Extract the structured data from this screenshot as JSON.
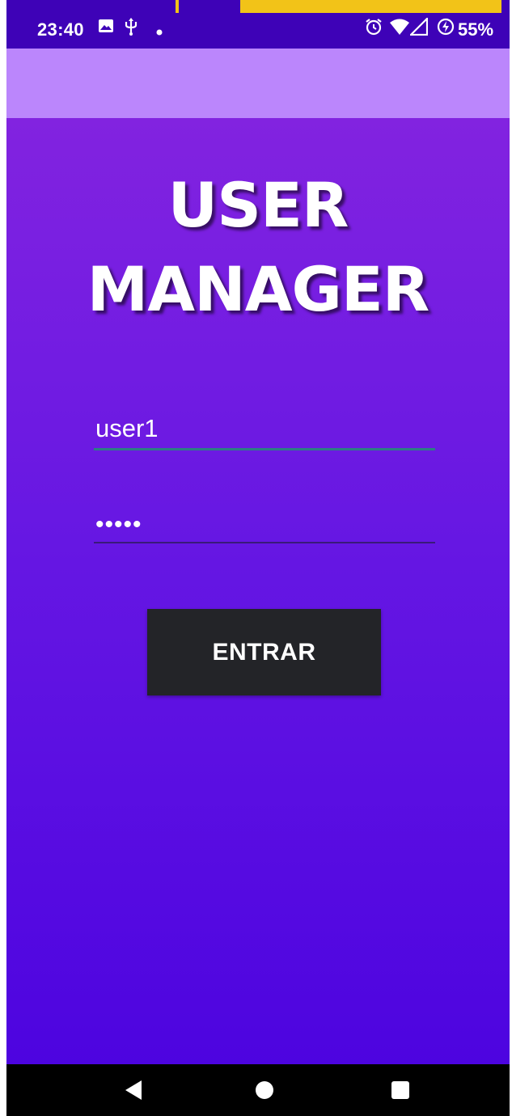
{
  "status_bar": {
    "time": "23:40",
    "battery": "55%",
    "icons": [
      "image-icon",
      "usb-icon",
      "dot-icon",
      "alarm-icon",
      "wifi-icon",
      "signal-icon",
      "battery-saver-icon"
    ]
  },
  "login": {
    "title_line1": "USER",
    "title_line2": "MANAGER",
    "username_value": "user1",
    "password_value": "•••••",
    "submit_label": "ENTRAR"
  },
  "nav": {
    "icons": [
      "back-icon",
      "home-icon",
      "recents-icon"
    ]
  },
  "colors": {
    "status_bar": "#3e02b7",
    "app_bar": "#bb86fc",
    "gradient_top": "#8223e0",
    "gradient_bottom": "#4d04e0",
    "button": "#232428",
    "accent_yellow": "#f2c318"
  }
}
